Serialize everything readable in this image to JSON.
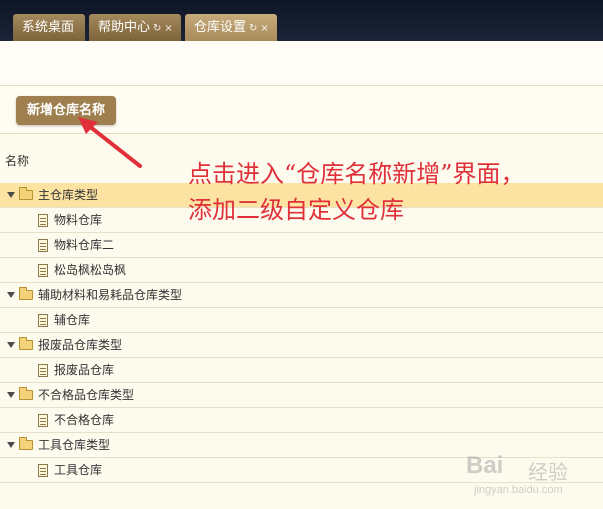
{
  "tabs": [
    {
      "label": "系统桌面",
      "active": false,
      "closable": false
    },
    {
      "label": "帮助中心",
      "active": false,
      "closable": true
    },
    {
      "label": "仓库设置",
      "active": true,
      "closable": true
    }
  ],
  "tab_controls": {
    "refresh": "↻",
    "close": "×"
  },
  "toolbar": {
    "add_button_label": "新增仓库名称"
  },
  "table": {
    "column_header": "名称"
  },
  "tree": [
    {
      "label": "主仓库类型",
      "children": [
        "物料仓库",
        "物料仓库二",
        "松岛枫松岛枫"
      ]
    },
    {
      "label": "辅助材料和易耗品仓库类型",
      "children": [
        "辅仓库"
      ]
    },
    {
      "label": "报废品仓库类型",
      "children": [
        "报废品仓库"
      ]
    },
    {
      "label": "不合格品仓库类型",
      "children": [
        "不合格仓库"
      ]
    },
    {
      "label": "工具仓库类型",
      "children": [
        "工具仓库"
      ]
    }
  ],
  "selected_node": "主仓库类型",
  "annotation": {
    "line1": "点击进入“仓库名称新增”界面，",
    "line2": "添加二级自定义仓库",
    "color": "#e0303a"
  },
  "watermark": {
    "text": "Bai",
    "sub": "经验",
    "url": "jingyan.baidu.com"
  },
  "colors": {
    "accent": "#9f7f4e",
    "tab_bar": "#111a2c",
    "selected_row": "#fde3a2",
    "background": "#fdfaee"
  }
}
